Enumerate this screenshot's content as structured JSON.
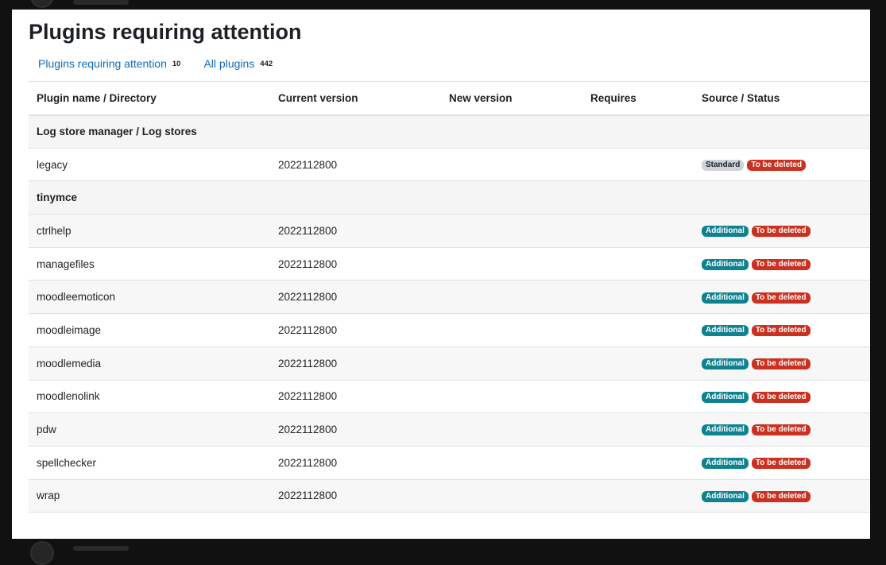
{
  "page": {
    "title": "Plugins requiring attention"
  },
  "tabs": [
    {
      "label": "Plugins requiring attention",
      "count": "10"
    },
    {
      "label": "All plugins",
      "count": "442"
    }
  ],
  "table": {
    "headers": [
      "Plugin name / Directory",
      "Current version",
      "New version",
      "Requires",
      "Source / Status"
    ],
    "groups": [
      {
        "name": "Log store manager / Log stores",
        "rows": [
          {
            "name": "legacy",
            "current_version": "2022112800",
            "new_version": "",
            "requires": "",
            "source": "Standard",
            "status": "To be deleted"
          }
        ]
      },
      {
        "name": "tinymce",
        "rows": [
          {
            "name": "ctrlhelp",
            "current_version": "2022112800",
            "new_version": "",
            "requires": "",
            "source": "Additional",
            "status": "To be deleted"
          },
          {
            "name": "managefiles",
            "current_version": "2022112800",
            "new_version": "",
            "requires": "",
            "source": "Additional",
            "status": "To be deleted"
          },
          {
            "name": "moodleemoticon",
            "current_version": "2022112800",
            "new_version": "",
            "requires": "",
            "source": "Additional",
            "status": "To be deleted"
          },
          {
            "name": "moodleimage",
            "current_version": "2022112800",
            "new_version": "",
            "requires": "",
            "source": "Additional",
            "status": "To be deleted"
          },
          {
            "name": "moodlemedia",
            "current_version": "2022112800",
            "new_version": "",
            "requires": "",
            "source": "Additional",
            "status": "To be deleted"
          },
          {
            "name": "moodlenolink",
            "current_version": "2022112800",
            "new_version": "",
            "requires": "",
            "source": "Additional",
            "status": "To be deleted"
          },
          {
            "name": "pdw",
            "current_version": "2022112800",
            "new_version": "",
            "requires": "",
            "source": "Additional",
            "status": "To be deleted"
          },
          {
            "name": "spellchecker",
            "current_version": "2022112800",
            "new_version": "",
            "requires": "",
            "source": "Additional",
            "status": "To be deleted"
          },
          {
            "name": "wrap",
            "current_version": "2022112800",
            "new_version": "",
            "requires": "",
            "source": "Additional",
            "status": "To be deleted"
          }
        ]
      }
    ]
  },
  "colors": {
    "link": "#0f6cbf",
    "badge_standard": "#ced4da",
    "badge_additional": "#0f8291",
    "badge_delete": "#ca3120"
  }
}
